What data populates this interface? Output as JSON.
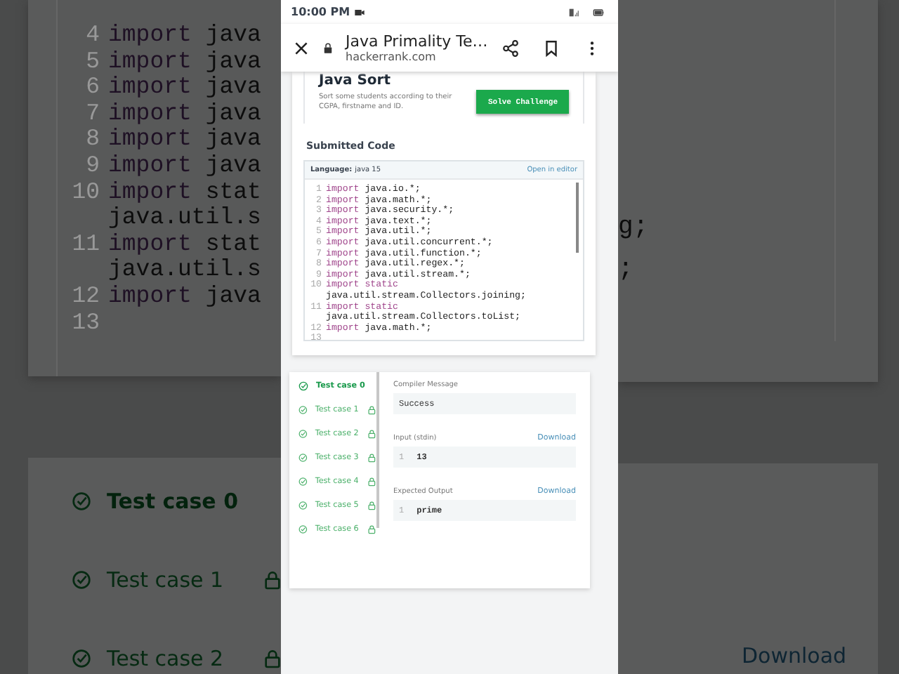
{
  "backdrop": {
    "code_lines": [
      {
        "num": "4",
        "keyword": "import",
        "text": "java"
      },
      {
        "num": "5",
        "keyword": "import",
        "text": "java"
      },
      {
        "num": "6",
        "keyword": "import",
        "text": "java"
      },
      {
        "num": "7",
        "keyword": "import",
        "text": "java"
      },
      {
        "num": "8",
        "keyword": "import",
        "text": "java"
      },
      {
        "num": "9",
        "keyword": "import",
        "text": "java"
      },
      {
        "num": "10",
        "keyword": "import",
        "text": "stat"
      },
      {
        "text": "java.util.s"
      },
      {
        "num": "11",
        "keyword": "import",
        "text": "stat"
      },
      {
        "text": "java.util.s"
      },
      {
        "num": "12",
        "keyword": "import",
        "text": "java"
      },
      {
        "num": "13"
      }
    ],
    "code_tails": [
      {
        "text": "g;"
      },
      {
        "text": ";"
      }
    ],
    "tests": [
      {
        "label": "Test case 0",
        "selected": true,
        "locked": false
      },
      {
        "label": "Test case 1",
        "selected": false,
        "locked": true
      },
      {
        "label": "Test case 2",
        "selected": false,
        "locked": true
      }
    ],
    "download": "Download"
  },
  "status_bar": {
    "time": "10:00 PM"
  },
  "app_bar": {
    "title": "Java Primality Te…",
    "url": "hackerrank.com"
  },
  "challenge": {
    "title": "Java Sort",
    "description": "Sort some students according to their CGPA, firstname and ID.",
    "button": "Solve Challenge"
  },
  "submitted_code": {
    "heading": "Submitted Code",
    "language_label": "Language:",
    "language": "java 15",
    "open_editor": "Open in editor",
    "lines": [
      {
        "num": "1",
        "keyword": "import",
        "text": "java.io.*;"
      },
      {
        "num": "2",
        "keyword": "import",
        "text": "java.math.*;"
      },
      {
        "num": "3",
        "keyword": "import",
        "text": "java.security.*;"
      },
      {
        "num": "4",
        "keyword": "import",
        "text": "java.text.*;"
      },
      {
        "num": "5",
        "keyword": "import",
        "text": "java.util.*;"
      },
      {
        "num": "6",
        "keyword": "import",
        "text": "java.util.concurrent.*;"
      },
      {
        "num": "7",
        "keyword": "import",
        "text": "java.util.function.*;"
      },
      {
        "num": "8",
        "keyword": "import",
        "text": "java.util.regex.*;"
      },
      {
        "num": "9",
        "keyword": "import",
        "text": "java.util.stream.*;"
      },
      {
        "num": "10",
        "keyword": "import static",
        "text": "java.util.stream.Collectors.joining;",
        "kind": "wrapped"
      },
      {
        "num": "11",
        "keyword": "import static",
        "text": "java.util.stream.Collectors.toList;",
        "kind": "wrapped"
      },
      {
        "num": "12",
        "keyword": "import",
        "text": "java.math.*;"
      },
      {
        "num": "13"
      }
    ]
  },
  "results": {
    "tests": [
      {
        "label": "Test case 0",
        "selected": true,
        "locked": false
      },
      {
        "label": "Test case 1",
        "selected": false,
        "locked": true
      },
      {
        "label": "Test case 2",
        "selected": false,
        "locked": true
      },
      {
        "label": "Test case 3",
        "selected": false,
        "locked": true
      },
      {
        "label": "Test case 4",
        "selected": false,
        "locked": true
      },
      {
        "label": "Test case 5",
        "selected": false,
        "locked": true
      },
      {
        "label": "Test case 6",
        "selected": false,
        "locked": true
      }
    ],
    "compiler_label": "Compiler Message",
    "compiler_message": "Success",
    "input_label": "Input (stdin)",
    "input_download": "Download",
    "input_lines": [
      {
        "num": "1",
        "text": "13"
      }
    ],
    "output_label": "Expected Output",
    "output_download": "Download",
    "output_lines": [
      {
        "num": "1",
        "text": "prime"
      }
    ]
  }
}
